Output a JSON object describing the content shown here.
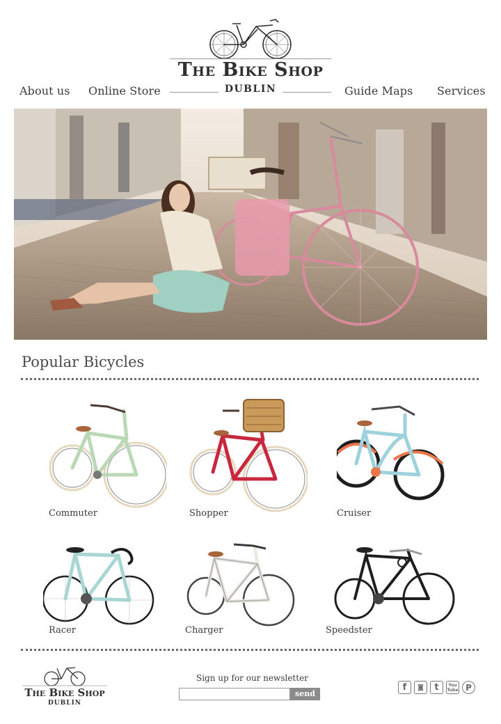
{
  "nav": {
    "left": [
      {
        "label": "About us"
      },
      {
        "label": "Online Store"
      }
    ],
    "right": [
      {
        "label": "Guide Maps"
      },
      {
        "label": "Services"
      }
    ]
  },
  "logo": {
    "title": "The Bike Shop",
    "subtitle": "DUBLIN"
  },
  "hero": {
    "alt": "woman sitting on cobblestone street beside pink bicycle"
  },
  "popular": {
    "title": "Popular Bicycles",
    "items": [
      {
        "label": "Commuter",
        "icon": "commuter-bike-image",
        "frame_color": "#b9d8b5"
      },
      {
        "label": "Shopper",
        "icon": "shopper-bike-image",
        "frame_color": "#c8283e"
      },
      {
        "label": "Cruiser",
        "icon": "cruiser-bike-image",
        "frame_color": "#9dd2dc"
      },
      {
        "label": "Racer",
        "icon": "racer-bike-image",
        "frame_color": "#a9d6d2"
      },
      {
        "label": "Charger",
        "icon": "charger-bike-image",
        "frame_color": "#ece8e2"
      },
      {
        "label": "Speedster",
        "icon": "speedster-bike-image",
        "frame_color": "#1e1e1e"
      }
    ]
  },
  "footer": {
    "logo_title": "The Bike Shop",
    "logo_subtitle": "DUBLIN",
    "newsletter_label": "Sign up for our newsletter",
    "newsletter_placeholder": "",
    "send_label": "send",
    "social": [
      {
        "icon": "facebook-icon",
        "glyph": "f"
      },
      {
        "icon": "instagram-icon",
        "glyph": "◙"
      },
      {
        "icon": "tumblr-icon",
        "glyph": "t"
      },
      {
        "icon": "youtube-icon",
        "glyph": "You Tube"
      },
      {
        "icon": "pinterest-icon",
        "glyph": "P"
      }
    ]
  },
  "colors": {
    "text": "#3a3a3a",
    "divider": "#6a6a6a",
    "button": "#8b8b8b"
  }
}
